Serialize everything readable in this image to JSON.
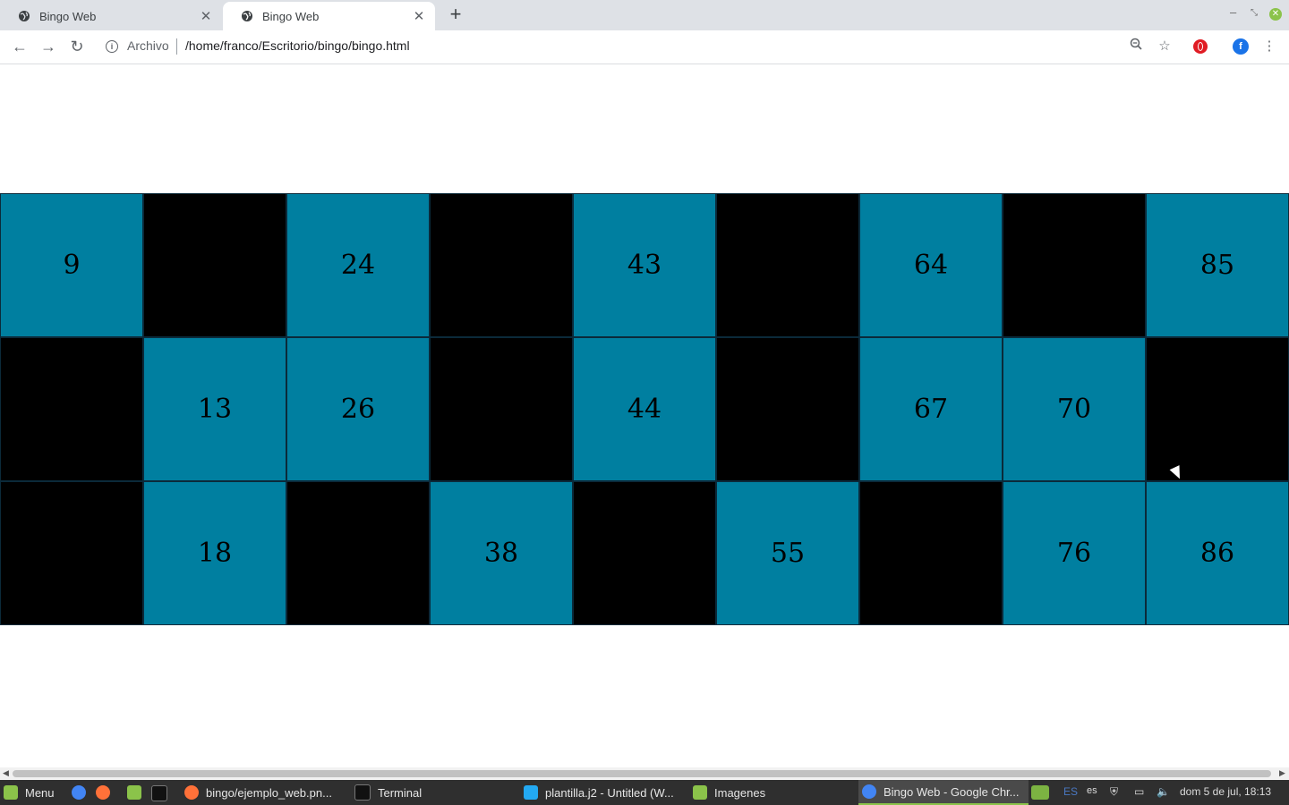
{
  "browser": {
    "tabs": [
      {
        "title": "Bingo Web",
        "active": false
      },
      {
        "title": "Bingo Web",
        "active": true
      }
    ],
    "new_tab_label": "+",
    "address": {
      "scheme_label": "Archivo",
      "url": "/home/franco/Escritorio/bingo/bingo.html"
    },
    "profile_initial": "f"
  },
  "bingo": {
    "rows": [
      [
        "9",
        "",
        "24",
        "",
        "43",
        "",
        "64",
        "",
        "85"
      ],
      [
        "",
        "13",
        "26",
        "",
        "44",
        "",
        "67",
        "70",
        ""
      ],
      [
        "",
        "18",
        "",
        "38",
        "",
        "55",
        "",
        "76",
        "86"
      ]
    ],
    "colors": {
      "number_cell": "#007fa0",
      "blank_cell": "#000000"
    }
  },
  "taskbar": {
    "menu_label": "Menu",
    "windows": [
      {
        "label": "bingo/ejemplo_web.pn...",
        "icon": "firefox-icon"
      },
      {
        "label": "Terminal",
        "icon": "terminal-icon"
      },
      {
        "label": "plantilla.j2 - Untitled (W...",
        "icon": "vscode-icon"
      },
      {
        "label": "Imagenes",
        "icon": "folder-icon"
      },
      {
        "label": "Bingo Web - Google Chr...",
        "icon": "chrome-icon",
        "active": true
      }
    ],
    "keyboard_layout": "ES",
    "keyboard_variant": "es",
    "clock": "dom  5 de jul, 18:13"
  }
}
